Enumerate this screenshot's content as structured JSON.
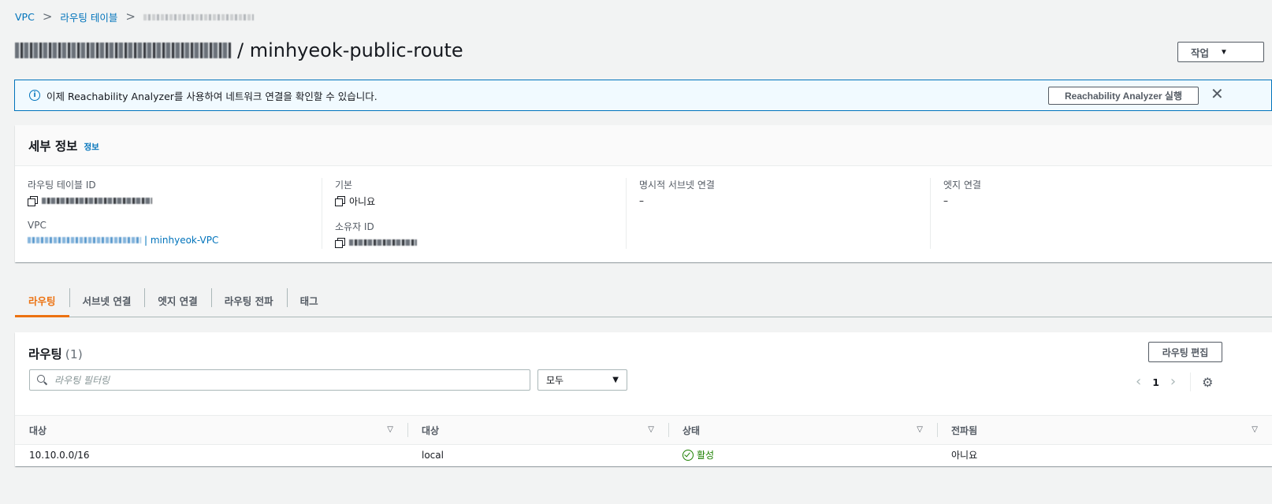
{
  "breadcrumb": {
    "items": [
      "VPC",
      "라우팅 테이블"
    ],
    "separator": ">"
  },
  "header": {
    "title_suffix": "/ minhyeok-public-route",
    "actions_label": "작업",
    "actions_caret": "▼"
  },
  "banner": {
    "icon": "info-icon",
    "message": "이제 Reachability Analyzer를 사용하여 네트워크 연결을 확인할 수 있습니다.",
    "button_label": "Reachability Analyzer 실행",
    "close_glyph": "✕"
  },
  "details": {
    "title": "세부 정보",
    "info_link": "정보",
    "fields": {
      "route_table_id_label": "라우팅 테이블 ID",
      "vpc_label": "VPC",
      "vpc_name": "| minhyeok-VPC",
      "main_label": "기본",
      "main_value": "아니요",
      "owner_label": "소유자 ID",
      "explicit_subnet_label": "명시적 서브넷 연결",
      "explicit_subnet_value": "–",
      "edge_label": "엣지 연결",
      "edge_value": "–"
    }
  },
  "tabs": [
    {
      "label": "라우팅",
      "active": true
    },
    {
      "label": "서브넷 연결",
      "active": false
    },
    {
      "label": "엣지 연결",
      "active": false
    },
    {
      "label": "라우팅 전파",
      "active": false
    },
    {
      "label": "태그",
      "active": false
    }
  ],
  "routes": {
    "title": "라우팅",
    "count": "(1)",
    "edit_label": "라우팅 편집",
    "filter_placeholder": "라우팅 필터링",
    "select_value": "모두",
    "select_caret": "▼",
    "page": "1",
    "prev_glyph": "‹",
    "next_glyph": "›",
    "settings_glyph": "⚙",
    "columns": [
      "대상",
      "대상",
      "상태",
      "전파됨"
    ],
    "sort_glyph": "▽",
    "rows": [
      {
        "destination": "10.10.0.0/16",
        "target": "local",
        "status": "활성",
        "propagated": "아니요"
      }
    ]
  },
  "colors": {
    "link": "#0073bb",
    "active_tab": "#ec7211",
    "status_ok": "#1d8102"
  }
}
